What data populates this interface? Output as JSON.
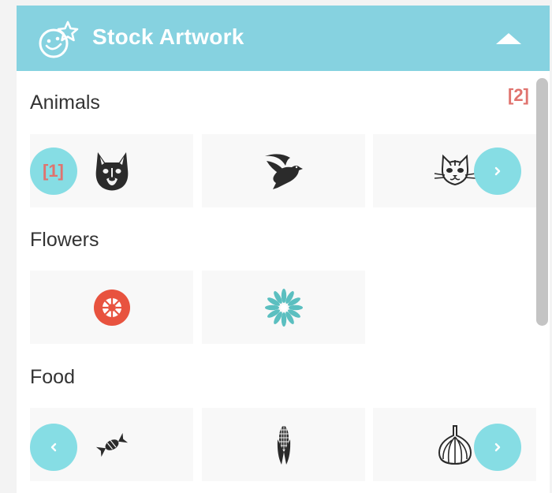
{
  "header": {
    "title": "Stock Artwork",
    "logo_icon": "smiley-star-icon",
    "collapse_icon": "caret-up-icon"
  },
  "markers": {
    "first": "[1]",
    "second": "[2]"
  },
  "categories": [
    {
      "title": "Animals",
      "items": [
        "french-bulldog-icon",
        "dove-icon",
        "cat-face-icon"
      ],
      "nav": [
        "next"
      ]
    },
    {
      "title": "Flowers",
      "items": [
        "red-flower-icon",
        "teal-daisy-icon"
      ],
      "nav": []
    },
    {
      "title": "Food",
      "items": [
        "wrapped-candy-icon",
        "corn-icon",
        "garlic-icon"
      ],
      "nav": [
        "prev",
        "next"
      ]
    }
  ],
  "colors": {
    "header": "#86d2e0",
    "nav_button": "#86dde4",
    "marker": "#e0736e",
    "flower_red": "#e8533f",
    "flower_teal": "#5bbfc0"
  }
}
